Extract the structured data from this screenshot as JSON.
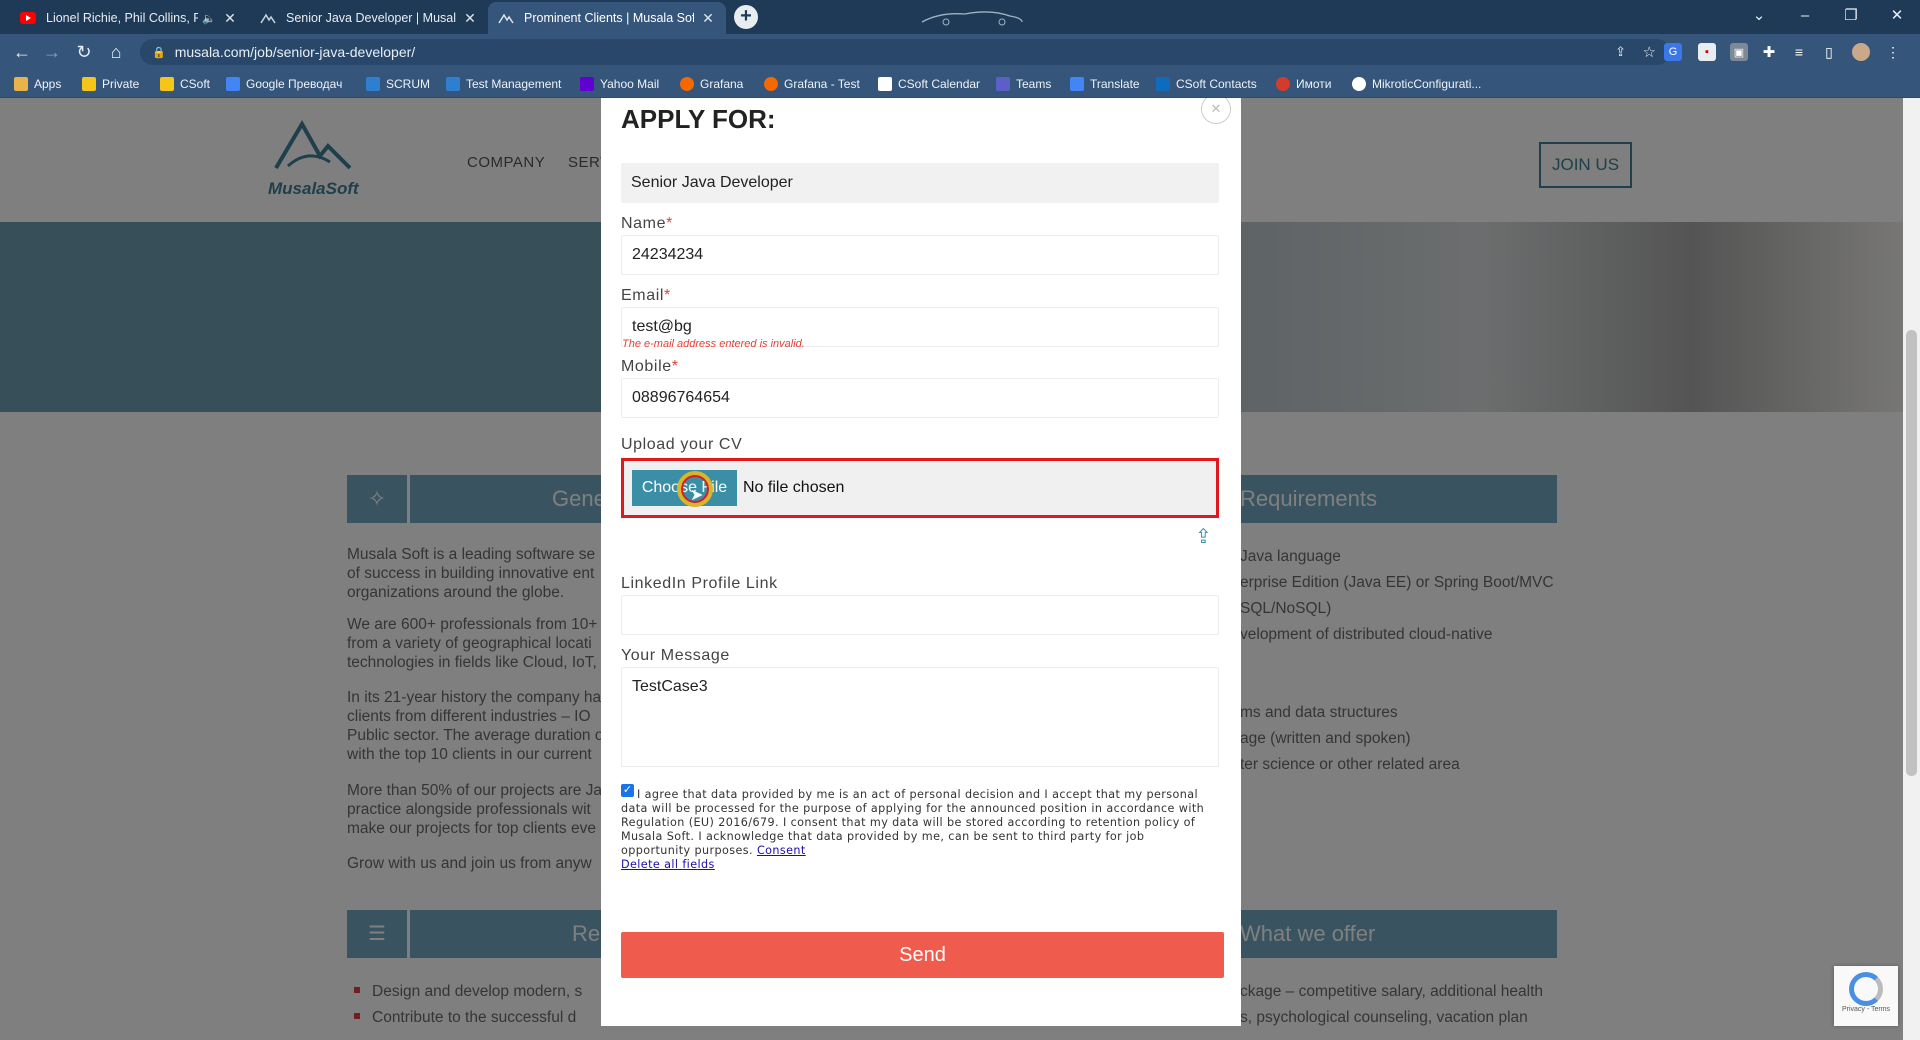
{
  "browser": {
    "tabs": [
      {
        "title": "Lionel Richie, Phil Collins, Ro",
        "icon": "youtube-icon",
        "muted_indicator": "🔈",
        "active": false
      },
      {
        "title": "Senior Java Developer | Musala S",
        "icon": "musala-icon",
        "active": false
      },
      {
        "title": "Prominent Clients | Musala Soft",
        "icon": "musala-icon",
        "active": true
      }
    ],
    "close_glyph": "✕",
    "url": "musala.com/job/senior-java-developer/",
    "bookmarks": [
      {
        "label": "Apps",
        "color": "#e8b34a"
      },
      {
        "label": "Private",
        "color": "#f5c518"
      },
      {
        "label": "CSoft",
        "color": "#f5c518"
      },
      {
        "label": "Google Преводач",
        "color": "#4285f4"
      },
      {
        "label": "SCRUM",
        "color": "#2f7fd1"
      },
      {
        "label": "Test Management",
        "color": "#2f7fd1"
      },
      {
        "label": "Yahoo Mail",
        "color": "#6001d2"
      },
      {
        "label": "Grafana",
        "color": "#f46800"
      },
      {
        "label": "Grafana - Test",
        "color": "#f46800"
      },
      {
        "label": "CSoft Calendar",
        "color": "#ffffff"
      },
      {
        "label": "Teams",
        "color": "#5b5fc7"
      },
      {
        "label": "Translate",
        "color": "#4285f4"
      },
      {
        "label": "CSoft Contacts",
        "color": "#0f6cbd"
      },
      {
        "label": "Имоти",
        "color": "#d33c2c"
      },
      {
        "label": "MikroticConfigurati...",
        "color": "#ffffff"
      }
    ]
  },
  "site": {
    "logo_text": "MusalaSoft",
    "nav": [
      "COMPANY",
      "SERV"
    ],
    "join_button": "JOIN US",
    "sections": {
      "general_title": "Gene",
      "requirements_title": "Requirements",
      "responsibilities_title": "Re",
      "offer_title": "What we offer"
    },
    "left_paragraphs": [
      "Musala Soft is a leading software se",
      "of success in building innovative ent",
      "organizations around the globe.",
      "We are 600+ professionals from 10+",
      "from a variety of geographical locati",
      "technologies in fields like Cloud, IoT,",
      "In its 21-year history the company ha",
      "clients from different industries  – IO",
      "Public sector. The average duration o",
      "with the top 10 clients in our current",
      "More than 50% of our projects are Ja",
      "practice alongside professionals wit",
      "make our projects for top clients eve",
      "Grow with us and join us from anyw"
    ],
    "right_lines": [
      "Java language",
      "erprise Edition (Java EE) or Spring Boot/MVC",
      "SQL/NoSQL)",
      "velopment of distributed cloud-native",
      "ms and data structures",
      "age (written and spoken)",
      "ter science or other related area"
    ],
    "bullets_left": [
      "Design and develop modern, s",
      "Contribute to the successful d"
    ],
    "bullets_right": [
      "ckage – competitive salary, additional health",
      "s, psychological counseling, vacation plan"
    ]
  },
  "modal": {
    "heading": "APPLY FOR:",
    "position": "Senior Java Developer",
    "name_label": "Name",
    "name_value": "24234234",
    "email_label": "Email",
    "email_value": "test@bg",
    "email_error": "The e-mail address entered is invalid.",
    "mobile_label": "Mobile",
    "mobile_value": "08896764654",
    "required_mark": "*",
    "cv_label": "Upload your CV",
    "choose_file_button": "Choose File",
    "no_file_text": "No file chosen",
    "linkedin_label": "LinkedIn Profile Link",
    "linkedin_value": "",
    "message_label": "Your Message",
    "message_value": "TestCase3",
    "consent_checked": true,
    "consent_text": "I agree that data provided by me is an act of personal decision and I accept that my personal data will be processed for the purpose of applying for the announced position in accordance with Regulation (EU) 2016/679. I consent that my data will be stored according to retention policy of Musala Soft. I acknowledge that data provided by me, can be sent to third party for job opportunity purposes.",
    "consent_link": "Consent",
    "delete_link": "Delete all fields",
    "send_button": "Send",
    "close_glyph": "✕",
    "colors": {
      "send": "#ef5b4c",
      "choose": "#3a8fa6",
      "highlight": "#e0191f",
      "required": "#e3413a"
    }
  },
  "recaptcha_text": "Privacy - Terms"
}
